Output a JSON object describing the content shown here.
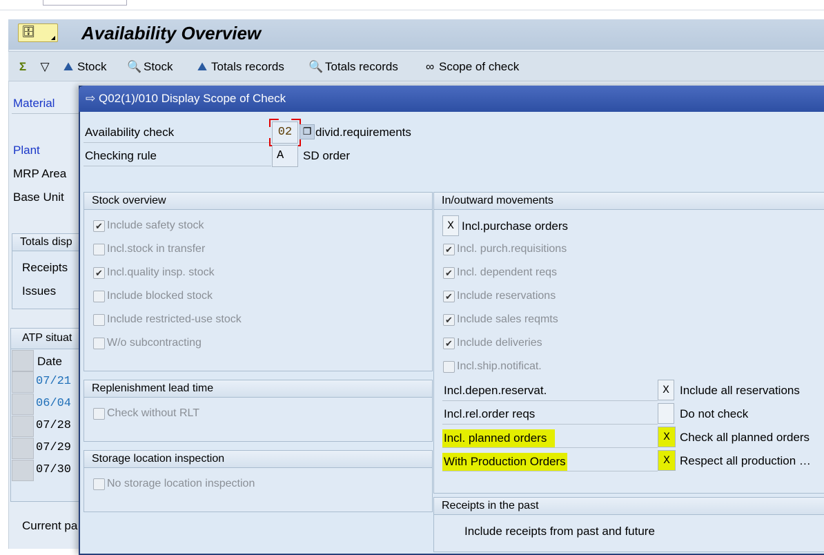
{
  "window": {
    "title": "Availability Overview"
  },
  "toolbar": {
    "items": [
      {
        "icon": "sigma-icon",
        "label": ""
      },
      {
        "icon": "filter-icon",
        "label": ""
      },
      {
        "icon": "person-mountain-icon",
        "label": "Stock"
      },
      {
        "icon": "monitor-magnifier-icon",
        "label": "Stock"
      },
      {
        "icon": "person-mountain-icon",
        "label": "Totals records"
      },
      {
        "icon": "monitor-magnifier-icon",
        "label": "Totals records"
      },
      {
        "icon": "glasses-icon",
        "label": "Scope of check"
      }
    ]
  },
  "background": {
    "material": "Material",
    "plant": "Plant",
    "mrp_area": "MRP Area",
    "base_unit": "Base Unit",
    "totals_tab": "Totals disp",
    "receipts": "Receipts",
    "issues": "Issues",
    "atp_tab": "ATP situat",
    "date_header": "Date",
    "dates": [
      "07/21",
      "06/04",
      "07/28",
      "07/29",
      "07/30"
    ],
    "current": "Current pa"
  },
  "dialog": {
    "title": "Q02(1)/010 Display Scope of Check",
    "availability_check": {
      "label": "Availability check",
      "value": "02",
      "desc": "divid.requirements"
    },
    "checking_rule": {
      "label": "Checking rule",
      "value": "A",
      "desc": "SD order"
    },
    "stock_overview": {
      "title": "Stock overview",
      "items": [
        {
          "label": "Include safety stock",
          "checked": true
        },
        {
          "label": "Incl.stock in transfer",
          "checked": false
        },
        {
          "label": "Incl.quality insp. stock",
          "checked": true
        },
        {
          "label": "Include blocked stock",
          "checked": false
        },
        {
          "label": "Include restricted-use stock",
          "checked": false
        },
        {
          "label": "W/o subcontracting",
          "checked": false
        }
      ]
    },
    "replenishment": {
      "title": "Replenishment lead time",
      "item": "Check without RLT"
    },
    "storage_location": {
      "title": "Storage location inspection",
      "item": "No storage location inspection"
    },
    "movements": {
      "title": "In/outward movements",
      "purchase_orders": {
        "label": "Incl.purchase orders",
        "value": "X"
      },
      "items": [
        {
          "label": "Incl. purch.requisitions",
          "checked": true
        },
        {
          "label": "Incl. dependent reqs",
          "checked": true
        },
        {
          "label": "Include reservations",
          "checked": true
        },
        {
          "label": "Include sales reqmts",
          "checked": true
        },
        {
          "label": "Include deliveries",
          "checked": true
        },
        {
          "label": "Incl.ship.notificat.",
          "checked": false
        }
      ],
      "options": [
        {
          "label": "Incl.depen.reservat.",
          "value": "X",
          "desc": "Include all reservations",
          "highlight": false
        },
        {
          "label": "Incl.rel.order reqs",
          "value": "",
          "desc": "Do not check",
          "highlight": false
        },
        {
          "label": "Incl. planned orders",
          "value": "X",
          "desc": "Check all planned orders",
          "highlight": true
        },
        {
          "label": "With Production Orders",
          "value": "X",
          "desc": "Respect all production …",
          "highlight": true
        }
      ]
    },
    "receipts_past": {
      "title": "Receipts in the past",
      "value": "Include receipts from past and future"
    }
  },
  "colors": {
    "dialog_header": "#2d4fa3",
    "highlight": "#e4ee00",
    "link_blue": "#1a37c8",
    "required_marker": "#e00000"
  }
}
